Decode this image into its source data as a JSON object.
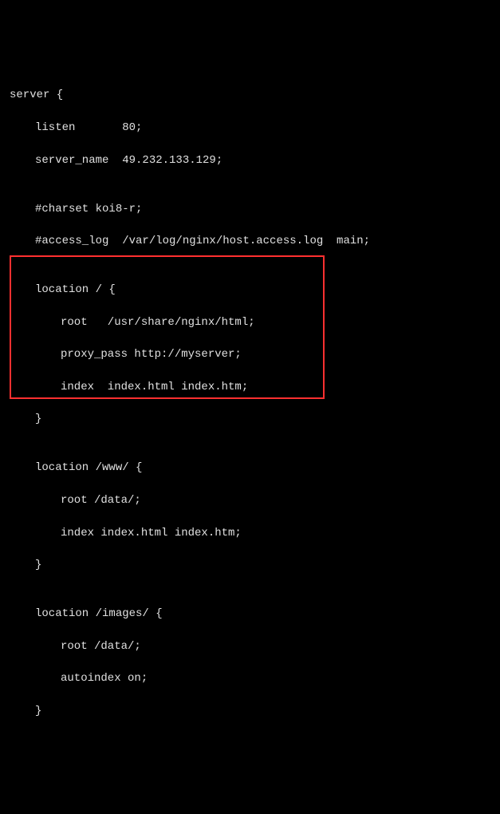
{
  "lines": {
    "l1": "server {",
    "l2": "listen       80;",
    "l3": "server_name  49.232.133.129;",
    "l4": "",
    "l5": "#charset koi8-r;",
    "l6": "#access_log  /var/log/nginx/host.access.log  main;",
    "l7": "",
    "l8": "location / {",
    "l9": "root   /usr/share/nginx/html;",
    "l10": "proxy_pass http://myserver;",
    "l11": "index  index.html index.htm;",
    "l12": "}",
    "l13": "",
    "l14": "location /www/ {",
    "l15": "root /data/;",
    "l16": "index index.html index.htm;",
    "l17": "}",
    "l18": "",
    "l19": "location /images/ {",
    "l20": "root /data/;",
    "l21": "autoindex on;",
    "l22": "}"
  }
}
